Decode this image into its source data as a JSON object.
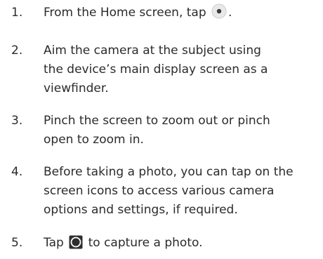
{
  "steps": [
    {
      "number": "1.",
      "lines": [
        "From the Home screen, tap"
      ],
      "icon": "camera-app-icon",
      "after_icon": "."
    },
    {
      "number": "2.",
      "lines": [
        "Aim the camera at the subject using",
        "the device’s main display screen as a",
        "viewfinder."
      ]
    },
    {
      "number": "3.",
      "lines": [
        "Pinch the screen to zoom out or pinch",
        "open to zoom in."
      ]
    },
    {
      "number": "4.",
      "lines": [
        "Before taking a photo, you can tap on the",
        "screen icons to access various camera",
        "options and settings, if required."
      ]
    },
    {
      "number": "5.",
      "lines": [
        "Tap"
      ],
      "icon": "shutter-button-icon",
      "after_icon": "to capture a photo."
    }
  ]
}
